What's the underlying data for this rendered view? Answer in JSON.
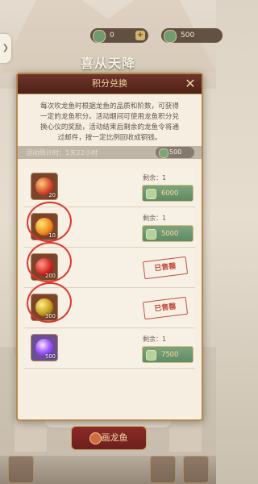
{
  "topbar": {
    "left_value": "0",
    "right_value": "500"
  },
  "side_tab_symbol": "❯",
  "banner_text": "喜从天降",
  "modal": {
    "title": "积分兑换",
    "close_symbol": "✕",
    "description_lines": [
      "每次吹龙鱼时根据龙鱼的品质和阶数，可获得",
      "一定的龙鱼积分。活动期间可使用龙鱼积分兑",
      "换心仪的奖励，活动结束后剩余的龙鱼令将通",
      "过邮件，按一定比例回收成铜钱。"
    ],
    "timer_text": "活动倒计时：1天22小时",
    "points_value": "500"
  },
  "rewards": [
    {
      "qty": "20",
      "remaining": "剩余：1",
      "price": "6000",
      "sold": ""
    },
    {
      "qty": "10",
      "remaining": "剩余：1",
      "price": "5000",
      "sold": ""
    },
    {
      "qty": "200",
      "remaining": "",
      "price": "",
      "sold": "已售罄"
    },
    {
      "qty": "300",
      "remaining": "",
      "price": "",
      "sold": "已售罄"
    },
    {
      "qty": "500",
      "remaining": "剩余：1",
      "price": "7500",
      "sold": ""
    }
  ],
  "bottom_button": "画龙鱼"
}
